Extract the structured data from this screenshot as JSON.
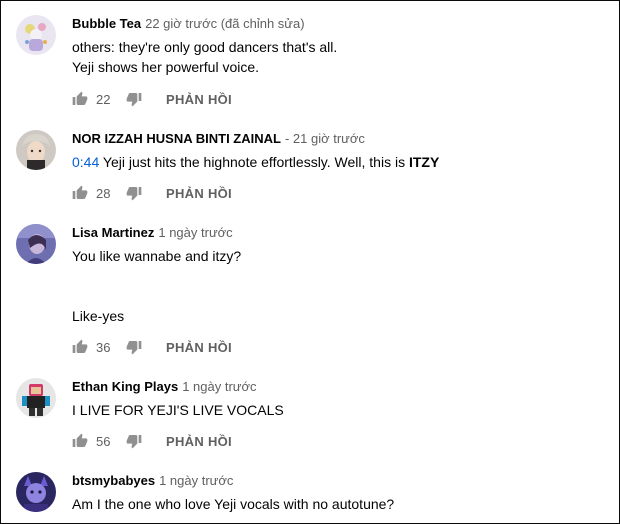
{
  "comments": [
    {
      "author": "Bubble Tea",
      "time": "22 giờ trước (đã chỉnh sửa)",
      "lines": [
        "others: they're only good dancers that's all.",
        "Yeji shows her powerful voice."
      ],
      "likes": "22",
      "reply": "PHẢN HỒI"
    },
    {
      "author": "NOR IZZAH HUSNA BINTI ZAINAL",
      "time": "- 21 giờ trước",
      "timestamp": "0:44",
      "text_mid": " Yeji just hits the highnote effortlessly. Well, this is ",
      "text_strong": "ITZY",
      "likes": "28",
      "reply": "PHẢN HỒI"
    },
    {
      "author": "Lisa Martinez",
      "time": "1 ngày trước",
      "lines": [
        "You like wannabe and itzy?",
        "Like-yes"
      ],
      "likes": "36",
      "reply": "PHẢN HỒI"
    },
    {
      "author": "Ethan King Plays",
      "time": "1 ngày trước",
      "lines": [
        "I LIVE FOR YEJI'S LIVE VOCALS"
      ],
      "likes": "56",
      "reply": "PHẢN HỒI"
    },
    {
      "author": "btsmybabyes",
      "time": "1 ngày trước",
      "lines": [
        "Am I the one who love Yeji vocals with no autotune?"
      ]
    }
  ],
  "colors": {
    "link": "#065fd4",
    "secondary": "#606060",
    "icon": "#909090"
  },
  "icons": {
    "like": "thumb-up-icon",
    "dislike": "thumb-down-icon"
  }
}
